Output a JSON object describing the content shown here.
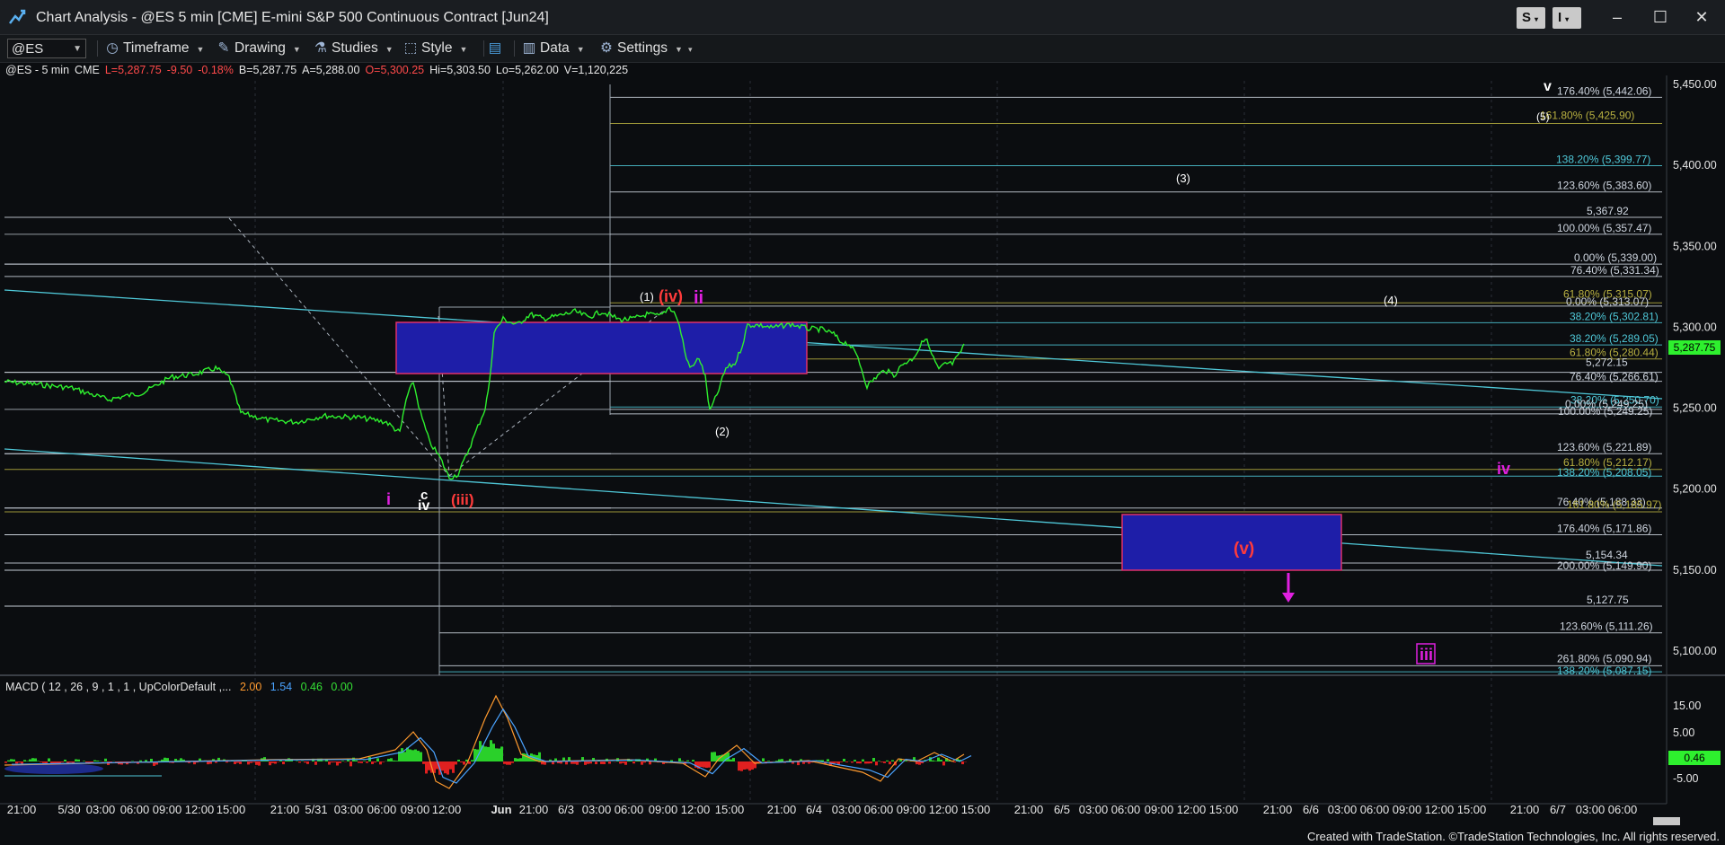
{
  "window": {
    "title": "Chart Analysis - @ES 5 min [CME] E-mini S&P 500 Continuous Contract [Jun24]",
    "buttons": [
      "S",
      "I"
    ],
    "controls": [
      "minimize",
      "maximize",
      "close"
    ]
  },
  "toolbar": {
    "symbol": "@ES",
    "items": [
      {
        "label": "Timeframe",
        "icon": "clock-icon"
      },
      {
        "label": "Drawing",
        "icon": "pencil-icon"
      },
      {
        "label": "Studies",
        "icon": "flask-icon"
      },
      {
        "label": "Style",
        "icon": "style-icon"
      },
      {
        "label": "",
        "icon": "layout-icon"
      },
      {
        "label": "Data",
        "icon": "bar-chart-icon"
      },
      {
        "label": "Settings",
        "icon": "gear-icon"
      }
    ]
  },
  "quote": {
    "symbol": "@ES - 5 min",
    "exchange": "CME",
    "last": "L=5,287.75",
    "change": "-9.50",
    "pct": "-0.18%",
    "bid": "B=5,287.75",
    "ask": "A=5,288.00",
    "open": "O=5,300.25",
    "high": "Hi=5,303.50",
    "low": "Lo=5,262.00",
    "volume": "V=1,120,225"
  },
  "macd_label": "MACD ( 12 , 26 , 9 , 1 , 1 , UpColorDefault ,...",
  "macd_values": [
    {
      "text": "2.00",
      "color": "#ff9a2e"
    },
    {
      "text": "1.54",
      "color": "#4aa3ff"
    },
    {
      "text": "0.46",
      "color": "#35e035"
    },
    {
      "text": "0.00",
      "color": "#35e035"
    }
  ],
  "colors": {
    "price_line": "#2ef02e",
    "box_fill": "#1e1ea8",
    "box_border": "#e0306a",
    "wave_red": "#ff3b3b",
    "wave_magenta": "#e020e0",
    "fib_white": "#cfd6e0",
    "fib_cyan": "#4fc8d8",
    "fib_olive": "#b8b040"
  },
  "chart_data": {
    "type": "line",
    "price_axis": {
      "ticks": [
        "5,450.00",
        "5,400.00",
        "5,350.00",
        "5,300.00",
        "5,250.00",
        "5,200.00",
        "5,150.00",
        "5,100.00"
      ],
      "last_price": "5,287.75"
    },
    "macd_axis": {
      "ticks": [
        "15.00",
        "5.00",
        "-5.00"
      ],
      "current": "0.46"
    },
    "time_axis": [
      "21:00",
      "5/30",
      "03:00",
      "06:00",
      "09:00",
      "12:00",
      "15:00",
      "21:00",
      "5/31",
      "03:00",
      "06:00",
      "09:00",
      "12:00",
      "Jun",
      "21:00",
      "6/3",
      "03:00",
      "06:00",
      "09:00",
      "12:00",
      "15:00",
      "21:00",
      "6/4",
      "03:00",
      "06:00",
      "09:00",
      "12:00",
      "15:00",
      "21:00",
      "6/5",
      "03:00",
      "06:00",
      "09:00",
      "12:00",
      "15:00",
      "21:00",
      "6/6",
      "03:00",
      "06:00",
      "09:00",
      "12:00",
      "15:00",
      "21:00",
      "6/7",
      "03:00",
      "06:00"
    ],
    "fib_labels": [
      {
        "text": "176.40% (5,442.06)",
        "price": 5442.06,
        "color": "#cfd6e0"
      },
      {
        "text": "161.80% (5,425.90)",
        "price": 5425.9,
        "color": "#b8b040"
      },
      {
        "text": "138.20% (5,399.77)",
        "price": 5399.77,
        "color": "#4fc8d8"
      },
      {
        "text": "123.60% (5,383.60)",
        "price": 5383.6,
        "color": "#cfd6e0"
      },
      {
        "text": "5,367.92",
        "price": 5367.92,
        "color": "#cfd6e0"
      },
      {
        "text": "100.00% (5,357.47)",
        "price": 5357.47,
        "color": "#cfd6e0"
      },
      {
        "text": "0.00% (5,339.00)",
        "price": 5339.0,
        "color": "#cfd6e0"
      },
      {
        "text": "76.40% (5,331.34)",
        "price": 5331.34,
        "color": "#cfd6e0"
      },
      {
        "text": "61.80% (5,315.07)",
        "price": 5315.07,
        "color": "#b8b040"
      },
      {
        "text": "0.00% (5,313.07)",
        "price": 5313.07,
        "color": "#cfd6e0"
      },
      {
        "text": "38.20% (5,302.81)",
        "price": 5302.81,
        "color": "#4fc8d8"
      },
      {
        "text": "38.20% (5,289.05)",
        "price": 5289.05,
        "color": "#4fc8d8"
      },
      {
        "text": "61.80% (5,280.44)",
        "price": 5280.44,
        "color": "#b8b040"
      },
      {
        "text": "5,272.15",
        "price": 5272.15,
        "color": "#cfd6e0"
      },
      {
        "text": "76.40% (5,266.61)",
        "price": 5266.61,
        "color": "#cfd6e0"
      },
      {
        "text": "38.20% (5,250.70)",
        "price": 5250.7,
        "color": "#4fc8d8"
      },
      {
        "text": "0.00% (5,249.25)",
        "price": 5249.25,
        "color": "#cfd6e0"
      },
      {
        "text": "100.00% (5,249.25)",
        "price": 5246.5,
        "color": "#cfd6e0"
      },
      {
        "text": "123.60% (5,221.89)",
        "price": 5221.89,
        "color": "#cfd6e0"
      },
      {
        "text": "61.80% (5,212.17)",
        "price": 5212.17,
        "color": "#b8b040"
      },
      {
        "text": "138.20% (5,208.05)",
        "price": 5208.05,
        "color": "#4fc8d8"
      },
      {
        "text": "76.40% (5,188.33)",
        "price": 5188.33,
        "color": "#cfd6e0"
      },
      {
        "text": "161.80% (5,185.97)",
        "price": 5185.97,
        "color": "#b8b040"
      },
      {
        "text": "176.40% (5,171.86)",
        "price": 5171.86,
        "color": "#cfd6e0"
      },
      {
        "text": "5,154.34",
        "price": 5154.34,
        "color": "#cfd6e0"
      },
      {
        "text": "200.00% (5,149.90)",
        "price": 5149.9,
        "color": "#cfd6e0"
      },
      {
        "text": "5,127.75",
        "price": 5127.75,
        "color": "#cfd6e0"
      },
      {
        "text": "123.60% (5,111.26)",
        "price": 5111.26,
        "color": "#cfd6e0"
      },
      {
        "text": "261.80% (5,090.94)",
        "price": 5090.94,
        "color": "#cfd6e0"
      },
      {
        "text": "138.20% (5,087.15)",
        "price": 5087.15,
        "color": "#4fc8d8"
      }
    ],
    "wave_labels": [
      {
        "text": "v",
        "color": "#ffffff"
      },
      {
        "text": "(5)",
        "color": "#ffffff"
      },
      {
        "text": "(3)",
        "color": "#ffffff"
      },
      {
        "text": "(4)",
        "color": "#ffffff"
      },
      {
        "text": "(1)",
        "color": "#ffffff"
      },
      {
        "text": "(iv)",
        "color": "#ff3b3b"
      },
      {
        "text": "ii",
        "color": "#e020e0"
      },
      {
        "text": "(2)",
        "color": "#ffffff"
      },
      {
        "text": "i",
        "color": "#e020e0"
      },
      {
        "text": "c",
        "color": "#ffffff"
      },
      {
        "text": "iv",
        "color": "#ffffff"
      },
      {
        "text": "(iii)",
        "color": "#ff3b3b"
      },
      {
        "text": "iv",
        "color": "#e020e0"
      },
      {
        "text": "(v)",
        "color": "#ff3b3b"
      },
      {
        "text": "iii",
        "color": "#e020e0"
      }
    ]
  },
  "footer": "Created with TradeStation. ©TradeStation Technologies, Inc. All rights reserved."
}
